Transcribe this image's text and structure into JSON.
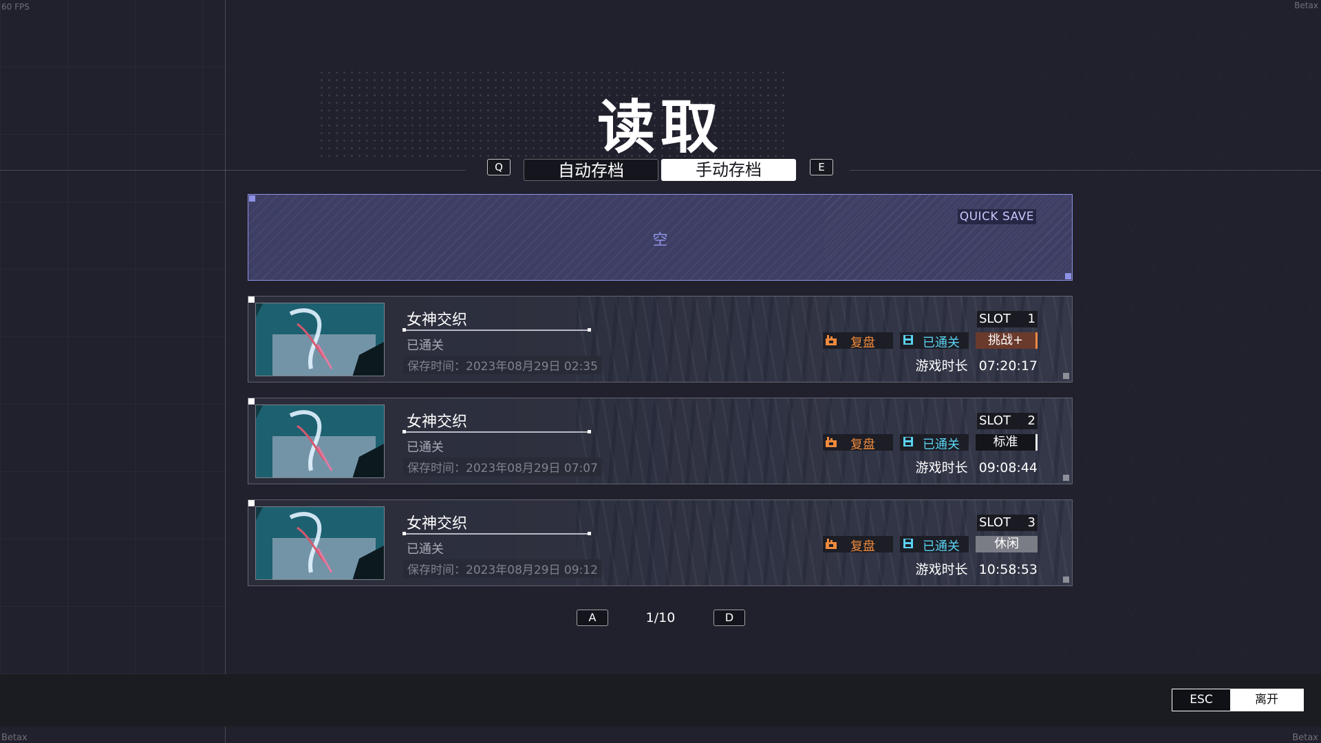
{
  "hud": {
    "fps": "60 FPS",
    "watermark": "Betax"
  },
  "page_title": "读取",
  "tabs": {
    "prev_key": "Q",
    "next_key": "E",
    "items": [
      {
        "label": "自动存档",
        "active": false
      },
      {
        "label": "手动存档",
        "active": true
      }
    ]
  },
  "quick_save": {
    "label": "QUICK SAVE",
    "empty_text": "空"
  },
  "slots": [
    {
      "game_name": "女神交织",
      "status": "已通关",
      "save_time": "保存时间：2023年08月29日 02:35",
      "slot_label": "SLOT",
      "slot_number": "1",
      "replay": "复盘",
      "cleared": "已通关",
      "difficulty": "挑战+",
      "playtime_label": "游戏时长",
      "playtime": "07:20:17"
    },
    {
      "game_name": "女神交织",
      "status": "已通关",
      "save_time": "保存时间：2023年08月29日 07:07",
      "slot_label": "SLOT",
      "slot_number": "2",
      "replay": "复盘",
      "cleared": "已通关",
      "difficulty": "标准",
      "playtime_label": "游戏时长",
      "playtime": "09:08:44"
    },
    {
      "game_name": "女神交织",
      "status": "已通关",
      "save_time": "保存时间：2023年08月29日 09:12",
      "slot_label": "SLOT",
      "slot_number": "3",
      "replay": "复盘",
      "cleared": "已通关",
      "difficulty": "休闲",
      "playtime_label": "游戏时长",
      "playtime": "10:58:53"
    }
  ],
  "pager": {
    "prev_key": "A",
    "next_key": "D",
    "page": "1/10"
  },
  "footer": {
    "esc_key": "ESC",
    "leave_label": "离开"
  },
  "colors": {
    "accent": "#8e92e6",
    "replay": "#f08a3c",
    "cleared": "#5ad3f2",
    "challenge_bg": "#6a3a2c"
  }
}
